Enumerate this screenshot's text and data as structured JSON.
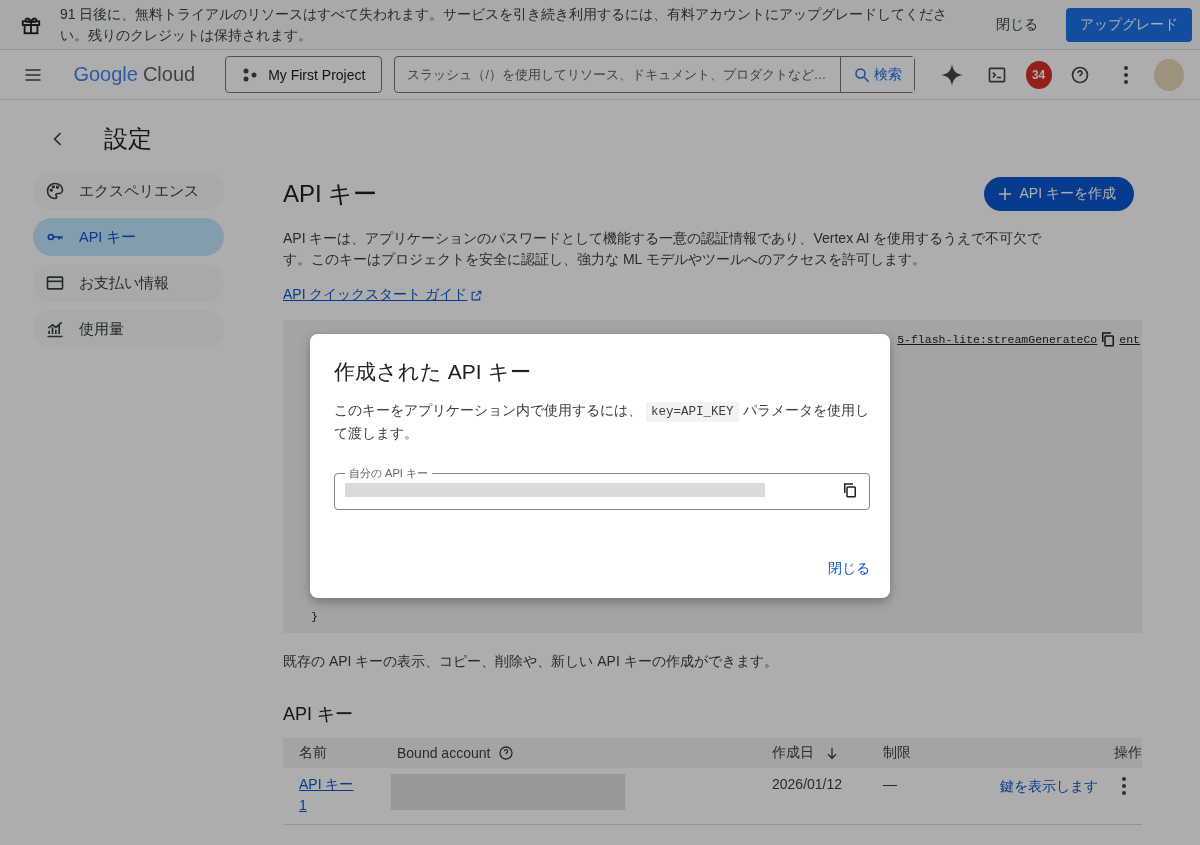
{
  "banner": {
    "message": "91 日後に、無料トライアルのリソースはすべて失われます。サービスを引き続き利用するには、有料アカウントにアップグレードしてください。残りのクレジットは保持されます。",
    "dismiss": "閉じる",
    "upgrade": "アップグレード"
  },
  "header": {
    "logo_word_1": "Google",
    "logo_word_2": "Cloud",
    "project": "My First Project",
    "search": {
      "placeholder": "スラッシュ（/）を使用してリソース、ドキュメント、プロダクトなど…",
      "button": "検索"
    },
    "notifications": "34"
  },
  "settings": {
    "title": "設定"
  },
  "sidebar": {
    "items": [
      {
        "label": "エクスペリエンス",
        "kind": "palette",
        "selected": false
      },
      {
        "label": "API キー",
        "kind": "key",
        "selected": true
      },
      {
        "label": "お支払い情報",
        "kind": "card",
        "selected": false
      },
      {
        "label": "使用量",
        "kind": "chart",
        "selected": false
      }
    ]
  },
  "main": {
    "title": "API キー",
    "create_button": "API キーを作成",
    "description": "API キーは、アプリケーションのパスワードとして機能する一意の認証情報であり、Vertex AI を使用するうえで不可欠です。このキーはプロジェクトを安全に認証し、強力な ML モデルやツールへのアクセスを許可します。",
    "guide_link": "API クイックスタート ガイド",
    "code": {
      "line_start": "5-flash-lite:streamGenerateCo",
      "line_end": "ent",
      "closing": "}"
    },
    "manage_text": "既存の API キーの表示、コピー、削除や、新しい API キーの作成ができます。",
    "table": {
      "title": "API キー",
      "columns": [
        "名前",
        "Bound account",
        "作成日",
        "制限",
        "操作"
      ],
      "rows": [
        {
          "name": "API キー 1",
          "created": "2026/01/12",
          "restriction": "—",
          "action": "鍵を表示します"
        }
      ]
    }
  },
  "dialog": {
    "title": "作成された API キー",
    "text_before": "このキーをアプリケーション内で使用するには、",
    "code": "key=API_KEY",
    "text_after": "パラメータを使用して渡します。",
    "field_label": "自分の API キー",
    "close": "閉じる"
  }
}
